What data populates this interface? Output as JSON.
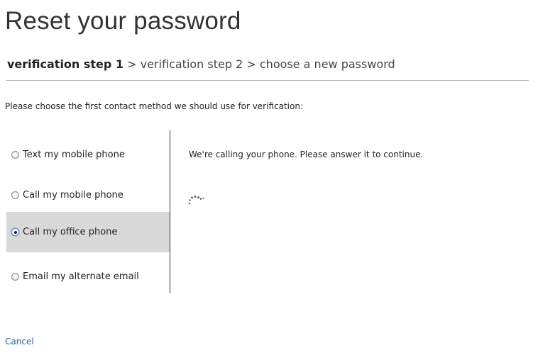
{
  "page": {
    "title": "Reset your password"
  },
  "breadcrumb": {
    "steps": [
      {
        "label": "verification step 1",
        "current": true
      },
      {
        "label": "verification step 2",
        "current": false
      },
      {
        "label": "choose a new password",
        "current": false
      }
    ],
    "separator": ">"
  },
  "prompt": "Please choose the first contact method we should use for verification:",
  "contact_methods": [
    {
      "label": "Text my mobile phone",
      "selected": false
    },
    {
      "label": "Call my mobile phone",
      "selected": false
    },
    {
      "label": "Call my office phone",
      "selected": true
    },
    {
      "label": "Email my alternate email",
      "selected": false
    }
  ],
  "status_message": "We're calling your phone. Please answer it to continue.",
  "cancel_label": "Cancel",
  "colors": {
    "link": "#2a5db0",
    "selected_background": "#d9d9d9"
  },
  "icons": {
    "spinner": "loading-spinner-icon"
  }
}
